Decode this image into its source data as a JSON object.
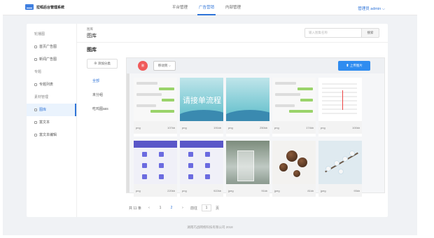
{
  "app": {
    "title": "拉呱后台管理系统"
  },
  "nav": {
    "items": [
      "平台管理",
      "广告营销",
      "内部管理"
    ],
    "active": 1
  },
  "user": {
    "label": "管理员 admin ⌵"
  },
  "sidebar": {
    "items": [
      {
        "label": "轮播图",
        "type": "group"
      },
      {
        "label": "首页广告图",
        "type": "item"
      },
      {
        "label": "新闻广告图",
        "type": "item"
      },
      {
        "label": "专题",
        "type": "group"
      },
      {
        "label": "专题列表",
        "type": "item"
      },
      {
        "label": "素材管理",
        "type": "group"
      },
      {
        "label": "图库",
        "type": "item",
        "active": true
      },
      {
        "label": "富文本",
        "type": "item"
      },
      {
        "label": "富文本编辑",
        "type": "item"
      }
    ]
  },
  "breadcrumb": {
    "parent": "图库",
    "current": "图库"
  },
  "search": {
    "placeholder": "输入图集名称",
    "button": "搜索"
  },
  "section": {
    "title": "图库"
  },
  "categories": {
    "add_label": "⊕ 添加分类",
    "items": [
      "全部",
      "未分组",
      "吃鸡图ass"
    ],
    "active": 0
  },
  "toolbar": {
    "delete_label": "删",
    "move_label": "移动到 ⌵",
    "upload_label": "⬆ 上传图片"
  },
  "images": [
    {
      "type": "png",
      "size": "107kb",
      "style": "chat"
    },
    {
      "type": "png",
      "size": "191kb",
      "style": "teal",
      "text": "请接单流程"
    },
    {
      "type": "png",
      "size": "250kb",
      "style": "teal",
      "text": ""
    },
    {
      "type": "png",
      "size": "174kb",
      "style": "chat"
    },
    {
      "type": "png",
      "size": "100kb",
      "style": "list"
    },
    {
      "type": "png",
      "size": "220kb",
      "style": "purple"
    },
    {
      "type": "png",
      "size": "922kb",
      "style": "purple"
    },
    {
      "type": "jpeg",
      "size": "91kb",
      "style": "water"
    },
    {
      "type": "jpeg",
      "size": "81kb",
      "style": "choco"
    },
    {
      "type": "jpeg",
      "size": "93kb",
      "style": "tree"
    }
  ],
  "pagination": {
    "total": "共 11 条",
    "prev": "‹",
    "pages": [
      "1",
      "2"
    ],
    "active_page": 1,
    "next": "›",
    "goto_label": "前往",
    "goto_value": "1",
    "page_suffix": "页"
  },
  "footer": {
    "text": "湖南巧战网络科技有限公司 2018"
  }
}
